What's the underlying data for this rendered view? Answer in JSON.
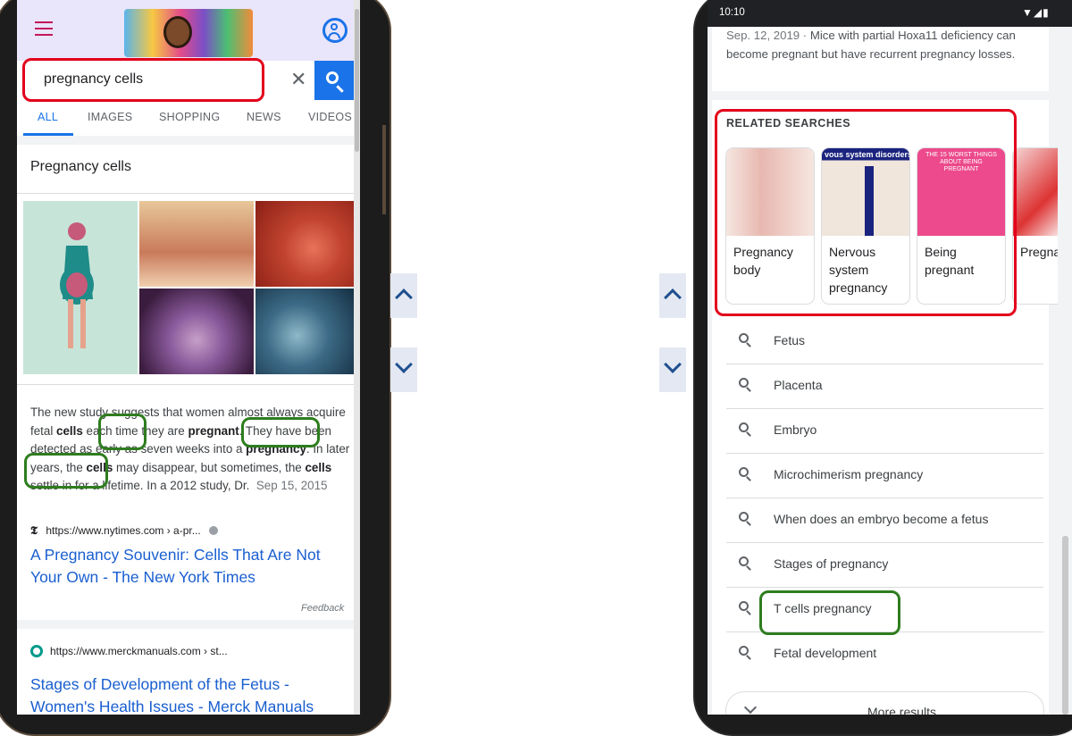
{
  "left_phone": {
    "search": {
      "query": "pregnancy cells",
      "clear_glyph": "✕"
    },
    "tabs": [
      "ALL",
      "IMAGES",
      "SHOPPING",
      "NEWS",
      "VIDEOS"
    ],
    "active_tab": "ALL",
    "knowledge_card": {
      "title": "Pregnancy cells"
    },
    "snippet": {
      "text_1": "The new study suggests that women almost always acquire fetal ",
      "b1": "cells",
      "text_2": " each time they are ",
      "b2": "pregnant",
      "text_3": ". They have been detected as early as seven weeks into a ",
      "b3": "pregnancy",
      "text_4": ". In later years, the ",
      "b4": "cells",
      "text_5": " may disappear, but sometimes, the ",
      "b5": "cells",
      "text_6": " settle in for a lifetime. In a 2012 study, Dr.",
      "date": "Sep 15, 2015"
    },
    "result_1": {
      "favicon": "𝕿",
      "url": "https://www.nytimes.com › a-pr...",
      "title": "A Pregnancy Souvenir: Cells That Are Not Your Own - The New York Times"
    },
    "feedback": "Feedback",
    "result_2": {
      "url": "https://www.merckmanuals.com › st...",
      "title": "Stages of Development of the Fetus - Women's Health Issues - Merck Manuals"
    }
  },
  "right_phone": {
    "status": {
      "time": "10:10",
      "icons": "▼◢▮"
    },
    "prev_snippet": {
      "date": "Sep. 12, 2019",
      "sep": " · ",
      "text": "Mice with partial Hoxa11 deficiency can become pregnant but have recurrent pregnancy losses."
    },
    "related_searches": {
      "title": "RELATED SEARCHES",
      "cards": [
        {
          "label": "Pregnancy body"
        },
        {
          "label": "Nervous system pregnancy",
          "image_caption": "vous system disorders"
        },
        {
          "label": "Being pregnant",
          "image_caption": "THE 15 WORST THINGS ABOUT BEING PREGNANT"
        },
        {
          "label": "Pregnancy nervous"
        }
      ]
    },
    "related_queries": [
      "Fetus",
      "Placenta",
      "Embryo",
      "Microchimerism pregnancy",
      "When does an embryo become a fetus",
      "Stages of pregnancy",
      "T cells pregnancy",
      "Fetal development"
    ],
    "more_results": "More results"
  },
  "colors": {
    "google_blue": "#1a73e8",
    "highlight_red": "#e3001b",
    "highlight_green": "#2e7d1e",
    "link_blue": "#1a5fd0"
  }
}
